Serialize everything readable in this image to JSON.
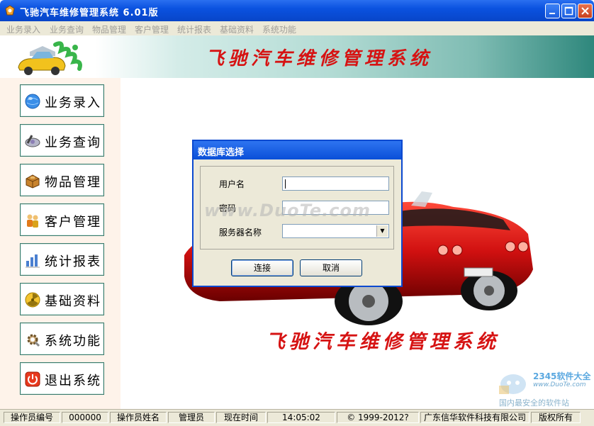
{
  "window": {
    "title": "飞驰汽车维修管理系统  6.01版"
  },
  "menu": [
    "业务录入",
    "业务查询",
    "物品管理",
    "客户管理",
    "统计报表",
    "基础资料",
    "系统功能"
  ],
  "banner": {
    "title": "飞驰汽车维修管理系统"
  },
  "sidebar": {
    "items": [
      {
        "label": "业务录入",
        "icon": "globe-icon"
      },
      {
        "label": "业务查询",
        "icon": "magnifier-icon"
      },
      {
        "label": "物品管理",
        "icon": "box-icon"
      },
      {
        "label": "客户管理",
        "icon": "people-icon"
      },
      {
        "label": "统计报表",
        "icon": "bar-chart-icon"
      },
      {
        "label": "基础资料",
        "icon": "radiation-icon"
      },
      {
        "label": "系统功能",
        "icon": "gear-icon"
      },
      {
        "label": "退出系统",
        "icon": "power-icon"
      }
    ]
  },
  "main": {
    "bottom_title": "飞驰汽车维修管理系统"
  },
  "dialog": {
    "title": "数据库选择",
    "username_label": "用户名",
    "username_value": "",
    "password_label": "密码",
    "password_value": "",
    "server_label": "服务器名称",
    "server_value": "",
    "connect_label": "连接",
    "cancel_label": "取消",
    "watermark": "www.DuoTe.com"
  },
  "corner_watermark": {
    "line1": "2345软件大全",
    "line2": "www.DuoTe.com",
    "line3": "国内最安全的软件站"
  },
  "status": {
    "operator_id_label": "操作员编号",
    "operator_id": "000000",
    "operator_name_label": "操作员姓名",
    "operator_name": "管理员",
    "time_label": "现在时间",
    "time": "14:05:02",
    "copyright": "© 1999-2012?",
    "company": "广东信华软件科技有限公司",
    "rights": "版权所有"
  },
  "colors": {
    "title_red": "#d61313",
    "titlebar_blue": "#0a52e0",
    "sidebar_bg": "#fef3ea"
  }
}
